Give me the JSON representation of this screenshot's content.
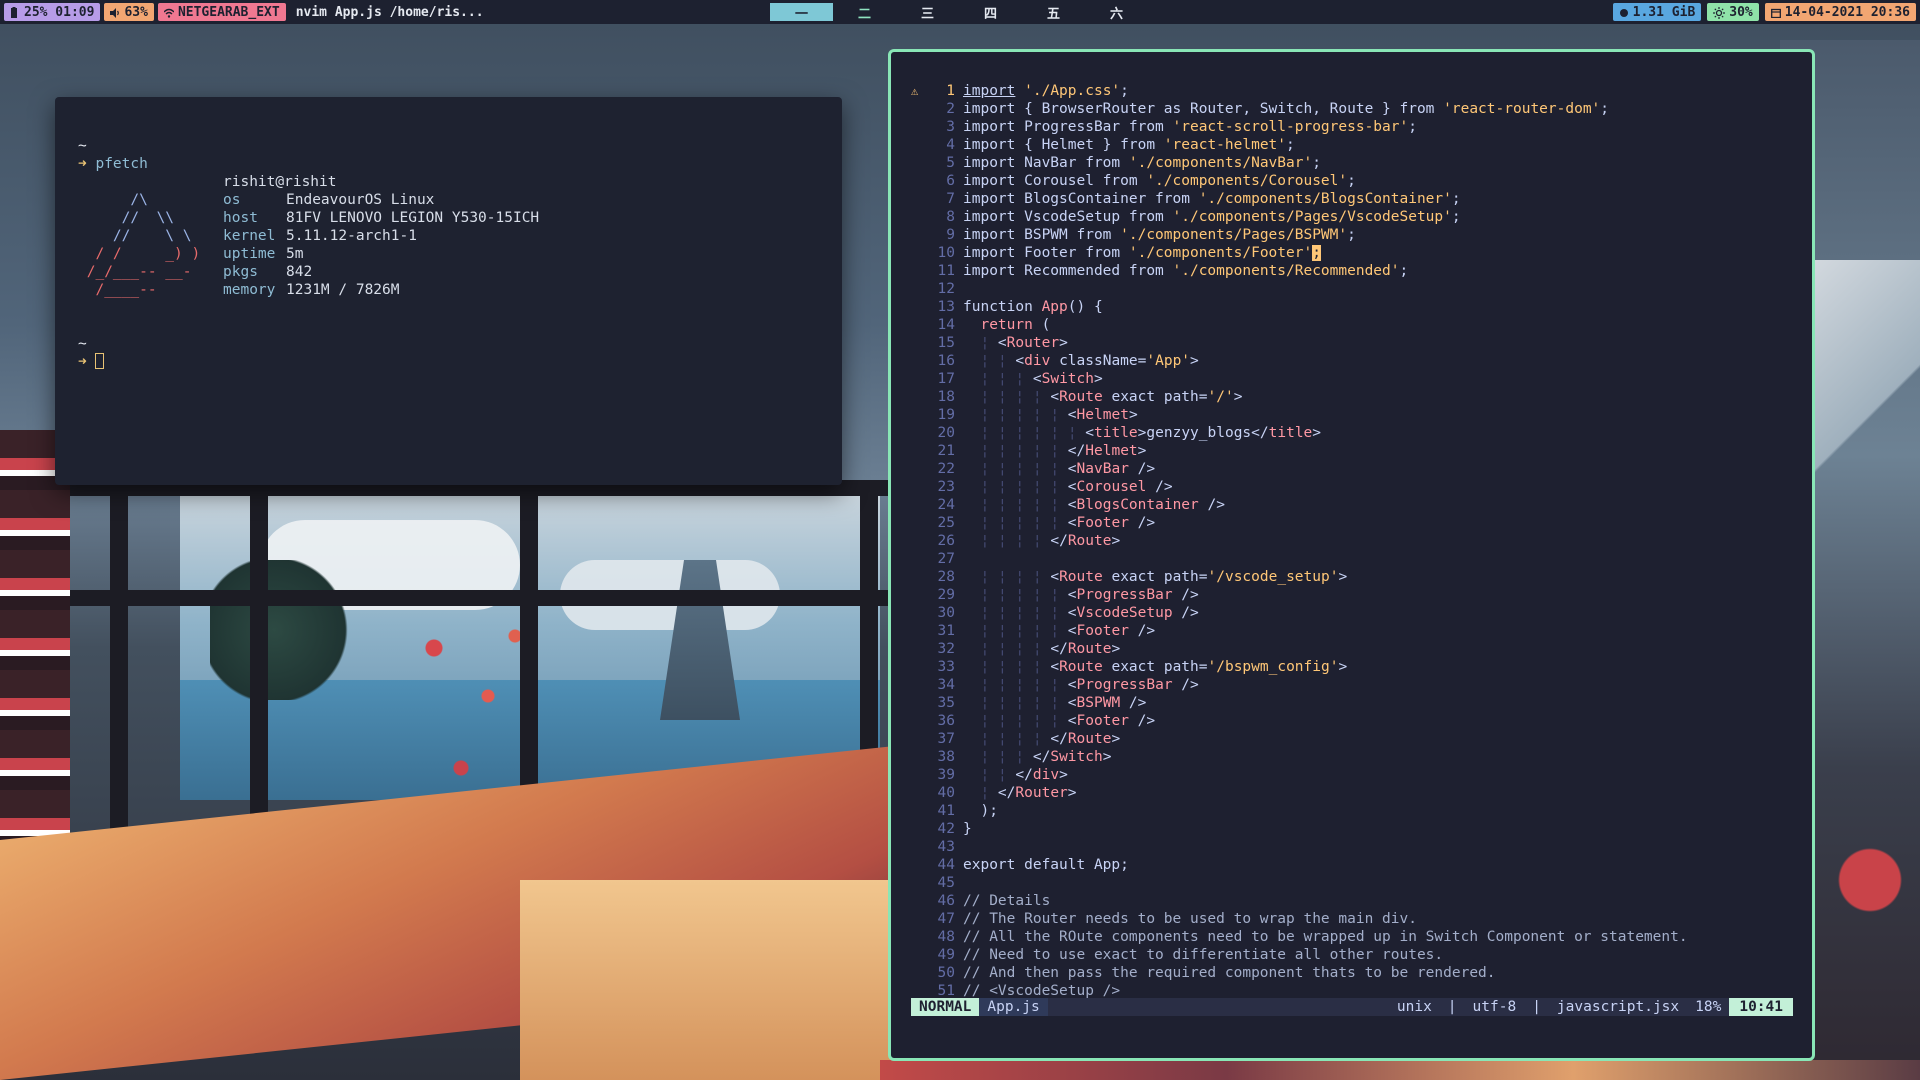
{
  "colors": {
    "bar_bg": "#1d2130",
    "battery": "#b79ce8",
    "volume": "#f2a672",
    "wifi": "#f07891",
    "memory": "#59a7e0",
    "brightness": "#8fe3a9",
    "date": "#f2a672",
    "nvim_border": "#89e6b6",
    "mode_bg": "#c3f0d8"
  },
  "topbar": {
    "battery": {
      "icon": "battery-icon",
      "text": "25% 01:09"
    },
    "volume": {
      "icon": "speaker-icon",
      "text": "63%"
    },
    "wifi": {
      "icon": "wifi-icon",
      "text": "NETGEARAB_EXT"
    },
    "window_title": "nvim App.js /home/ris...",
    "workspaces": [
      {
        "label": "一",
        "state": "active"
      },
      {
        "label": "二",
        "state": "occupied"
      },
      {
        "label": "三",
        "state": "empty"
      },
      {
        "label": "四",
        "state": "empty"
      },
      {
        "label": "五",
        "state": "empty"
      },
      {
        "label": "六",
        "state": "empty"
      }
    ],
    "memory": {
      "icon": "memory-icon",
      "text": "1.31 GiB"
    },
    "brightness": {
      "icon": "sun-icon",
      "text": "30%"
    },
    "datetime": {
      "icon": "calendar-icon",
      "text": "14-04-2021 20:36"
    }
  },
  "terminal": {
    "prompt_dir": "~",
    "prompt_arrow": "➜",
    "command": "pfetch",
    "user_host": "rishit@rishit",
    "logo": [
      "      /\\",
      "     //  \\\\",
      "    //    \\ \\",
      "  / /     _) )",
      " /_/___-- __-",
      "  /____--"
    ],
    "info": [
      {
        "key": "os",
        "value": "EndeavourOS Linux"
      },
      {
        "key": "host",
        "value": "81FV LENOVO LEGION Y530-15ICH"
      },
      {
        "key": "kernel",
        "value": "5.11.12-arch1-1"
      },
      {
        "key": "uptime",
        "value": "5m"
      },
      {
        "key": "pkgs",
        "value": "842"
      },
      {
        "key": "memory",
        "value": "1231M / 7826M"
      }
    ],
    "prompt2_dir": "~",
    "prompt2_arrow": "➜"
  },
  "editor": {
    "warning_sign": "⚠",
    "current_line": 1,
    "lines": [
      "import './App.css';",
      "import { BrowserRouter as Router, Switch, Route } from 'react-router-dom';",
      "import ProgressBar from 'react-scroll-progress-bar';",
      "import { Helmet } from 'react-helmet';",
      "import NavBar from './components/NavBar';",
      "import Corousel from './components/Corousel';",
      "import BlogsContainer from './components/BlogsContainer';",
      "import VscodeSetup from './components/Pages/VscodeSetup';",
      "import BSPWM from './components/Pages/BSPWM';",
      "import Footer from './components/Footer';",
      "import Recommended from './components/Recommended';",
      "",
      "function App() {",
      "  return (",
      "    <Router>",
      "      <div className='App'>",
      "        <Switch>",
      "          <Route exact path='/'>",
      "            <Helmet>",
      "              <title>genzyy_blogs</title>",
      "            </Helmet>",
      "            <NavBar />",
      "            <Corousel />",
      "            <BlogsContainer />",
      "            <Footer />",
      "          </Route>",
      "",
      "          <Route exact path='/vscode_setup'>",
      "            <ProgressBar />",
      "            <VscodeSetup />",
      "            <Footer />",
      "          </Route>",
      "          <Route exact path='/bspwm_config'>",
      "            <ProgressBar />",
      "            <BSPWM />",
      "            <Footer />",
      "          </Route>",
      "        </Switch>",
      "      </div>",
      "    </Router>",
      "  );",
      "}",
      "",
      "export default App;",
      "",
      "// Details",
      "// The Router needs to be used to wrap the main div.",
      "// All the ROute components need to be wrapped up in Switch Component or statement.",
      "// Need to use exact to differentiate all other routes.",
      "// And then pass the required component thats to be rendered.",
      "// <VscodeSetup />"
    ]
  },
  "statusline": {
    "mode": "NORMAL",
    "filename": "App.js",
    "fileformat": "unix",
    "encoding": "utf-8",
    "filetype": "javascript.jsx",
    "percent": "18%",
    "position": "10:41",
    "separator": "|"
  }
}
